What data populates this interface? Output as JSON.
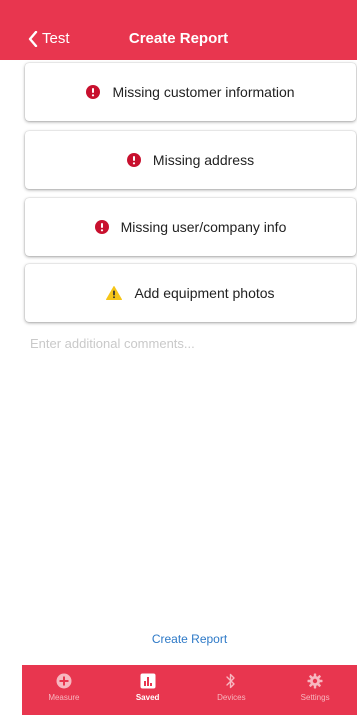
{
  "header": {
    "back_label": "Test",
    "title": "Create Report"
  },
  "items": [
    {
      "label": "Missing customer information",
      "icon": "error-icon"
    },
    {
      "label": "Missing address",
      "icon": "error-icon"
    },
    {
      "label": "Missing user/company info",
      "icon": "error-icon"
    },
    {
      "label": "Add equipment photos",
      "icon": "warning-icon"
    }
  ],
  "comments": {
    "placeholder": "Enter additional comments..."
  },
  "actions": {
    "create_report": "Create Report"
  },
  "tabs": [
    {
      "label": "Measure",
      "icon": "plus-circle-icon",
      "active": false
    },
    {
      "label": "Saved",
      "icon": "chart-icon",
      "active": true
    },
    {
      "label": "Devices",
      "icon": "bluetooth-icon",
      "active": false
    },
    {
      "label": "Settings",
      "icon": "gear-icon",
      "active": false
    }
  ],
  "colors": {
    "brand": "#e8364f",
    "error": "#c8102e",
    "warning": "#f5c518",
    "link": "#2d79c7"
  }
}
